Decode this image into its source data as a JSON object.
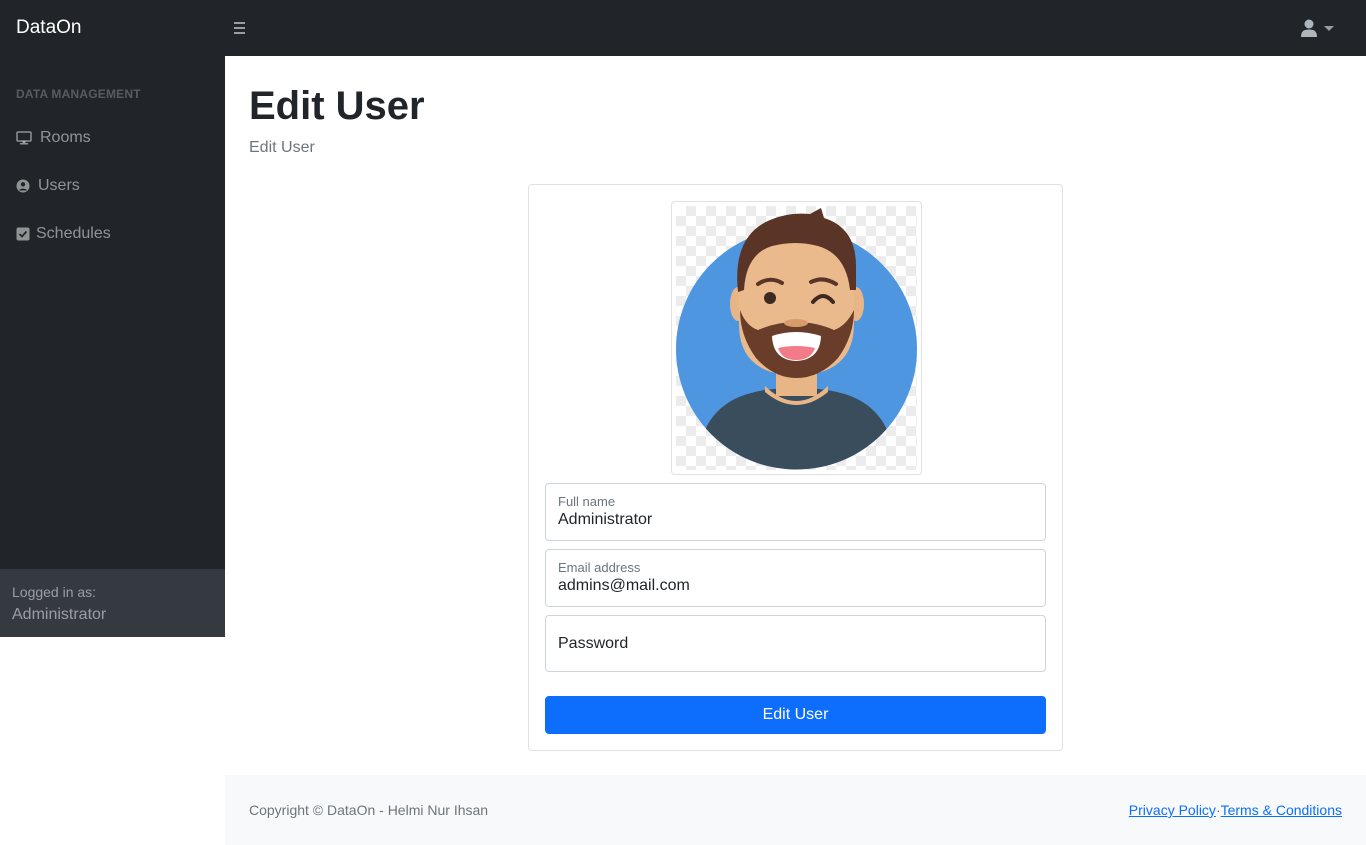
{
  "navbar": {
    "brand": "DataOn",
    "toggle_icon": "hamburger-icon",
    "user_icon": "user-icon"
  },
  "sidebar": {
    "heading": "DATA MANAGEMENT",
    "items": [
      {
        "label": "Rooms",
        "icon": "monitor-icon"
      },
      {
        "label": "Users",
        "icon": "user-circle-icon"
      },
      {
        "label": "Schedules",
        "icon": "check-square-icon"
      }
    ],
    "footer": {
      "logged_in_label": "Logged in as:",
      "username": "Administrator"
    }
  },
  "main": {
    "title": "Edit User",
    "breadcrumb": "Edit User"
  },
  "form": {
    "full_name": {
      "label": "Full name",
      "value": "Administrator"
    },
    "email": {
      "label": "Email address",
      "value": "admins@mail.com"
    },
    "password": {
      "placeholder": "Password"
    },
    "submit_label": "Edit User"
  },
  "footer": {
    "copyright": "Copyright © DataOn - Helmi Nur Ihsan",
    "privacy": "Privacy Policy",
    "separator": "·",
    "terms": "Terms & Conditions"
  },
  "colors": {
    "dark": "#212529",
    "primary": "#0d6efd",
    "avatar_bg": "#4f96e1"
  }
}
